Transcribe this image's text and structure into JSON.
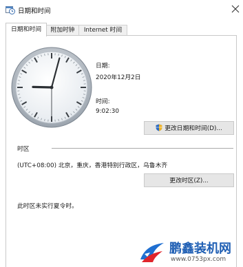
{
  "window": {
    "title": "日期和时间",
    "icon": "calendar-clock-icon"
  },
  "tabs": [
    {
      "label": "日期和时间",
      "active": true
    },
    {
      "label": "附加时钟",
      "active": false
    },
    {
      "label": "Internet 时间",
      "active": false
    }
  ],
  "datetime": {
    "date_label": "日期:",
    "date_value": "2020年12月2日",
    "time_label": "时间:",
    "time_value": "9:02:30",
    "change_button_label": "更改日期和时间(D)..."
  },
  "clock": {
    "hour": 9,
    "minute": 2,
    "second": 30
  },
  "timezone": {
    "heading": "时区",
    "value": "(UTC+08:00) 北京，重庆，香港特别行政区，乌鲁木齐",
    "change_button_label": "更改时区(Z)...",
    "dst_note": "此时区未实行夏令时。"
  },
  "watermark": {
    "title": "鹏鑫装机网",
    "url": "www.0753px.com"
  }
}
